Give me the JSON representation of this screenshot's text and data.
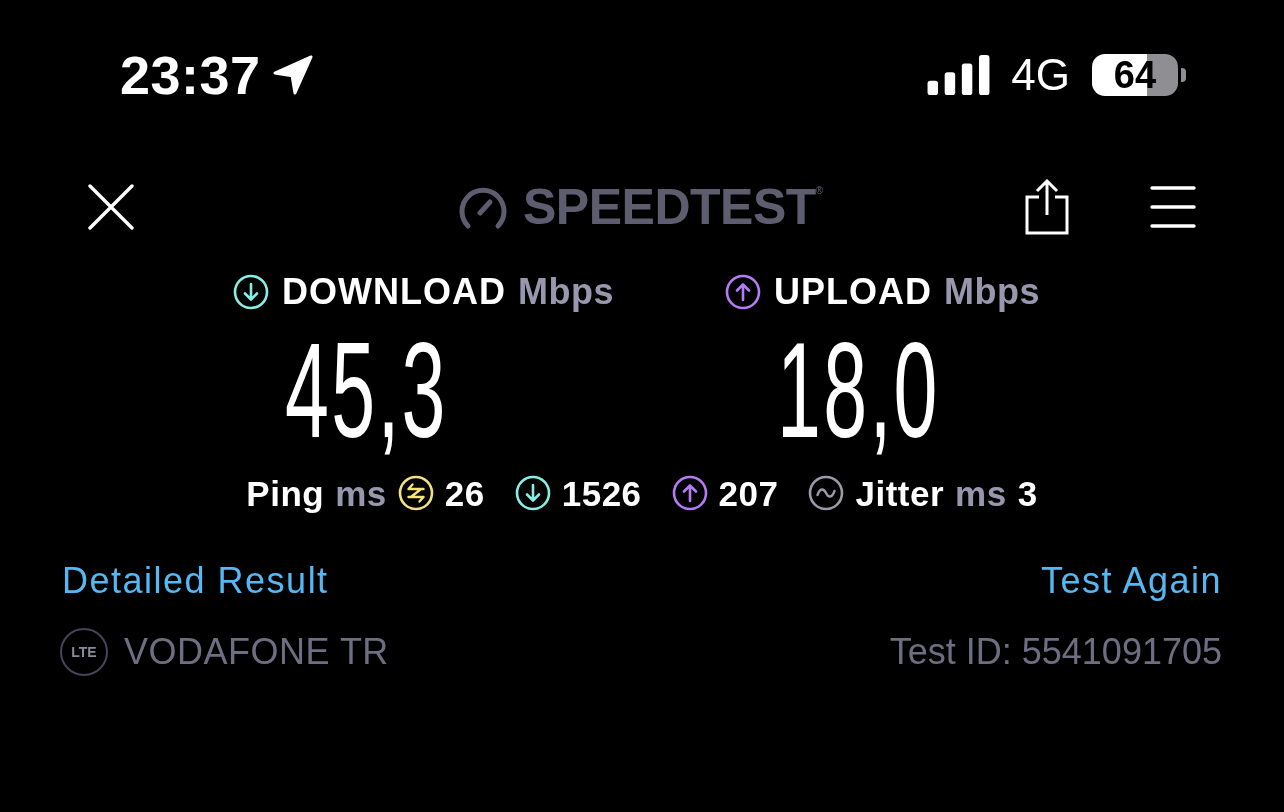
{
  "status_bar": {
    "time": "23:37",
    "network": "4G",
    "battery": "64"
  },
  "header": {
    "logo": "SPEEDTEST$^{®}$"
  },
  "results": [
    {
      "kind": "download",
      "label": "DOWNLOAD",
      "unit": "Mbps",
      "value": "45,3"
    },
    {
      "kind": "upload",
      "label": "UPLOAD",
      "unit": "Mbps",
      "value": "18,0"
    }
  ],
  "latency": [
    {
      "kind": "ping",
      "label": "Ping",
      "unit": "ms",
      "value": "26"
    },
    {
      "kind": "download",
      "value": "1526"
    },
    {
      "kind": "upload",
      "value": "207"
    },
    {
      "kind": "jitter",
      "label": "Jitter",
      "unit": "ms",
      "value": "3"
    }
  ],
  "links": {
    "detail": "Detailed Result",
    "retry": "Test Again"
  },
  "provider": {
    "network_type": "LTE",
    "name": "VODAFONE TR",
    "test_id": "Test ID: 5541091705"
  }
}
